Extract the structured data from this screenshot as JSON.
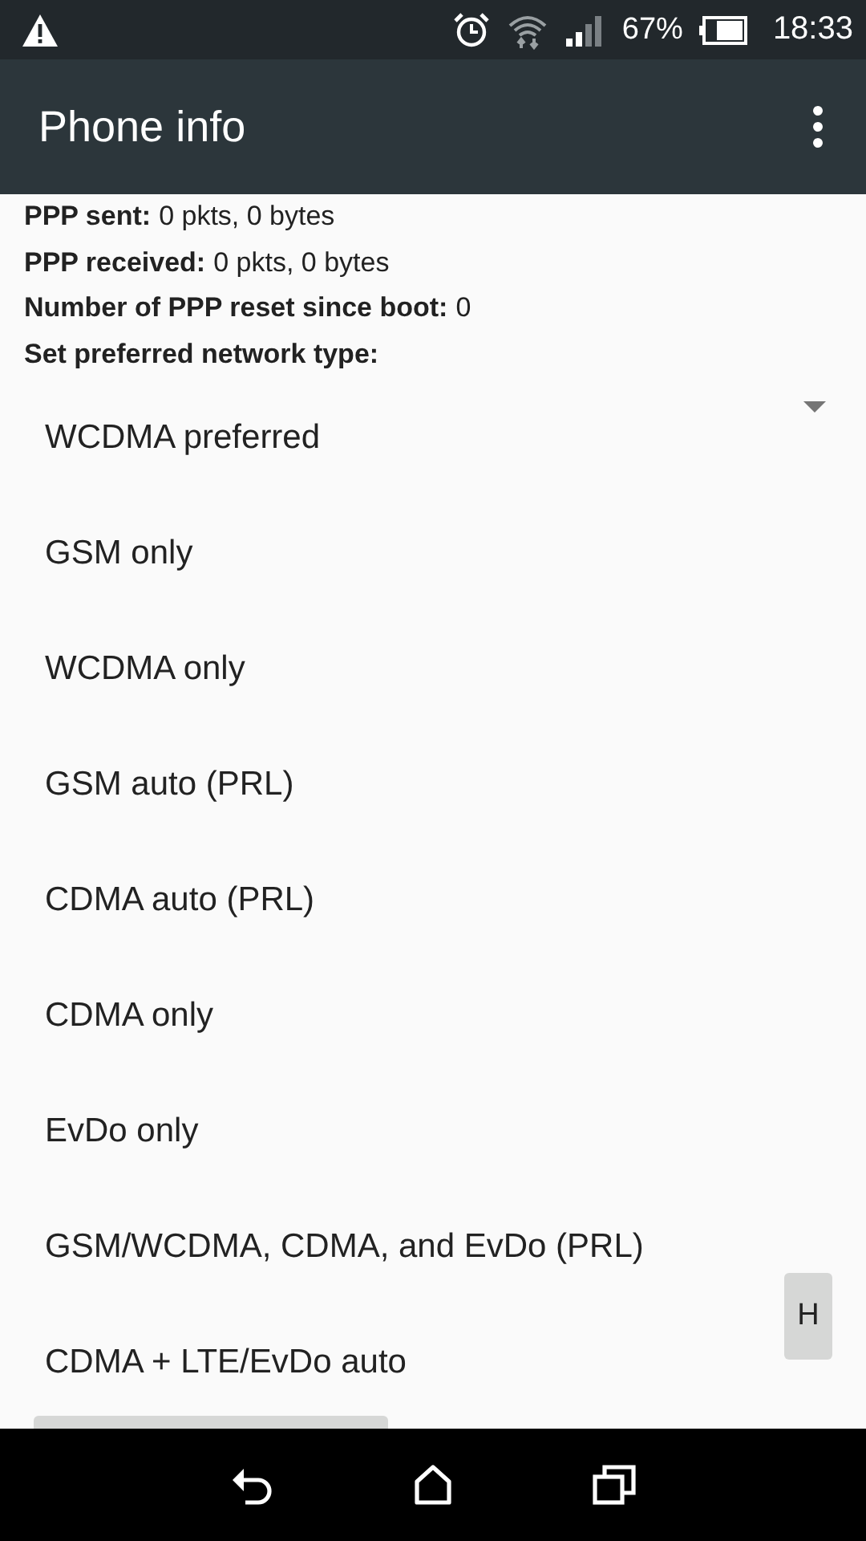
{
  "status_bar": {
    "battery": "67%",
    "time": "18:33"
  },
  "app_bar": {
    "title": "Phone info"
  },
  "info": [
    {
      "label": "PPP sent:",
      "value": "0 pkts, 0 bytes"
    },
    {
      "label": "PPP received:",
      "value": "0 pkts, 0 bytes"
    },
    {
      "label": "Number of PPP reset since boot:",
      "value": "0"
    },
    {
      "label": "Set preferred network type:"
    }
  ],
  "network_type": {
    "value": "WCDMA preferred",
    "options": [
      "GSM only",
      "WCDMA only",
      "GSM auto (PRL)",
      "CDMA auto (PRL)",
      "CDMA only",
      "EvDo only",
      "GSM/WCDMA, CDMA, and EvDo (PRL)",
      "CDMA + LTE/EvDo auto"
    ]
  },
  "side_button": {
    "label": "H"
  }
}
